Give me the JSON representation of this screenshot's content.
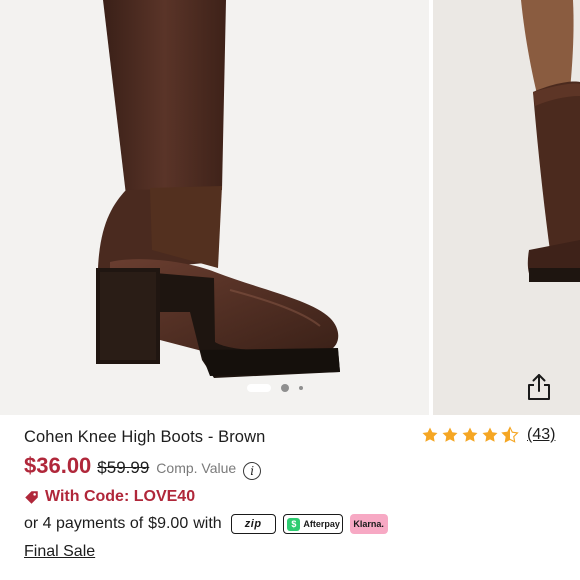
{
  "gallery": {
    "images": [
      "boot-side-view",
      "boot-on-model"
    ],
    "active_index": 0,
    "dot_count": 3
  },
  "product": {
    "title": "Cohen Knee High Boots - Brown",
    "rating_value": 4.5,
    "review_count": "(43)",
    "price": "$36.00",
    "compare_price": "$59.99",
    "comp_label": "Comp. Value",
    "info_icon_glyph": "i",
    "promo": "With Code: LOVE40",
    "installment_prefix": "or 4 payments of",
    "installment_amount": "$9.00",
    "installment_suffix": "with",
    "final_sale": "Final Sale"
  },
  "payment_badges": {
    "zip": "zip",
    "afterpay": "Afterpay",
    "afterpay_mark": "$",
    "klarna": "Klarna."
  },
  "colors": {
    "price_red": "#b0273a",
    "star_gold": "#f5a623",
    "klarna_pink": "#f7a9c4",
    "afterpay_green": "#2ecc71"
  },
  "icons": [
    "share-icon",
    "star-icon",
    "tag-icon",
    "info-icon"
  ]
}
